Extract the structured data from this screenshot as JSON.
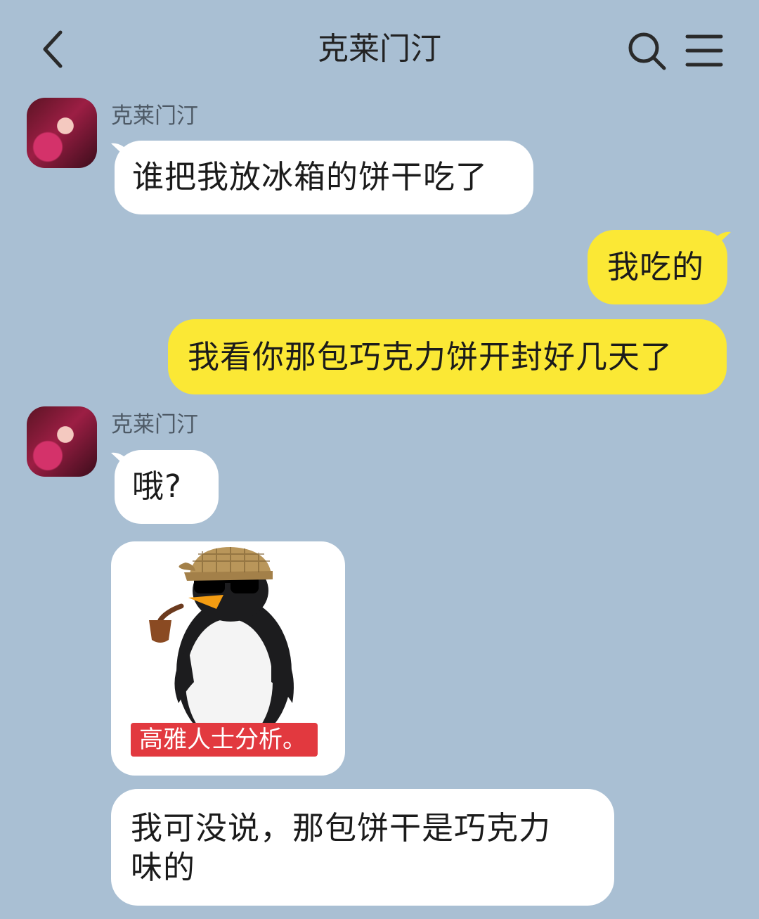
{
  "header": {
    "title": "克莱门汀",
    "back_icon": "chevron-left-icon",
    "search_icon": "search-icon",
    "menu_icon": "hamburger-menu-icon"
  },
  "messages": [
    {
      "side": "incoming",
      "sender": "克莱门汀",
      "text": "谁把我放冰箱的饼干吃了"
    },
    {
      "side": "outgoing",
      "text": "我吃的"
    },
    {
      "side": "outgoing",
      "text": "我看你那包巧克力饼开封好几天了"
    },
    {
      "side": "incoming",
      "sender": "克莱门汀",
      "text": "哦?"
    },
    {
      "side": "incoming",
      "type": "sticker",
      "sticker_caption": "高雅人士分析。",
      "sticker_icon": "penguin-detective-icon"
    },
    {
      "side": "incoming",
      "text_line1": "我可没说，那包饼干是巧克力",
      "text_line2": "味的"
    }
  ],
  "colors": {
    "background": "#a9bfd3",
    "incoming_bubble": "#ffffff",
    "outgoing_bubble": "#fbe835",
    "sticker_caption_bg": "#e2393f"
  }
}
